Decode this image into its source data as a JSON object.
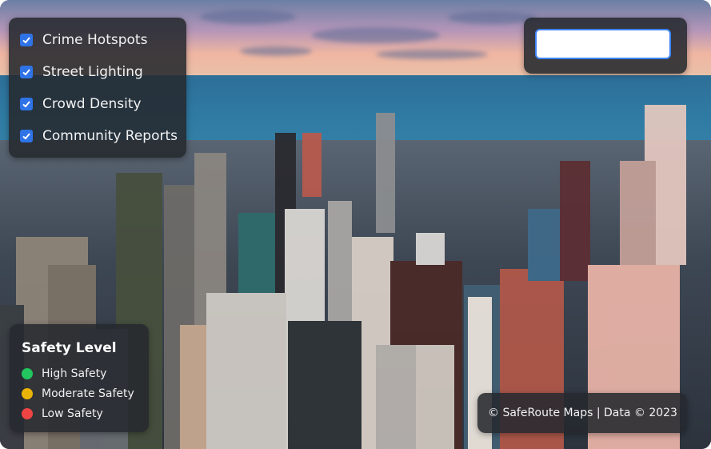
{
  "colors": {
    "accent": "#2f73e6",
    "search_border": "#3b82f6",
    "panel_bg": "#26292f",
    "high_safety": "#22c55e",
    "moderate_safety": "#eab308",
    "low_safety": "#ef4444"
  },
  "layers": {
    "items": [
      {
        "label": "Crime Hotspots",
        "checked": true
      },
      {
        "label": "Street Lighting",
        "checked": true
      },
      {
        "label": "Crowd Density",
        "checked": true
      },
      {
        "label": "Community Reports",
        "checked": true
      }
    ]
  },
  "search": {
    "value": "",
    "placeholder": ""
  },
  "legend": {
    "title": "Safety Level",
    "items": [
      {
        "label": "High Safety",
        "color": "#22c55e"
      },
      {
        "label": "Moderate Safety",
        "color": "#eab308"
      },
      {
        "label": "Low Safety",
        "color": "#ef4444"
      }
    ]
  },
  "attribution": {
    "text": "© SafeRoute Maps | Data © 2023"
  },
  "background": {
    "icon": "city-skyline-image"
  }
}
